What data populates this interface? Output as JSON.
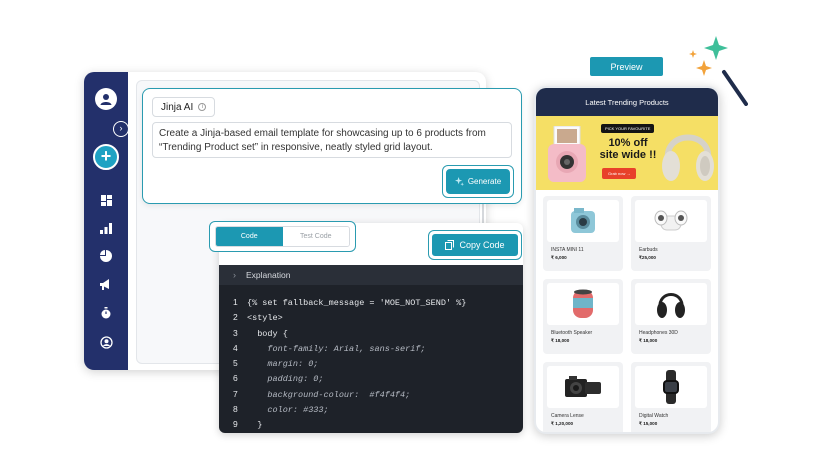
{
  "prompt": {
    "chip_label": "Jinja AI",
    "info_icon": "info-icon",
    "text": "Create a Jinja-based email template for showcasing up to 6 products from “Trending Product set” in responsive, neatly styled grid layout.",
    "generate_label": "Generate"
  },
  "code_panel": {
    "tabs": [
      {
        "label": "Code"
      },
      {
        "label": "Test Code"
      }
    ],
    "copy_label": "Copy Code",
    "explanation_label": "Explanation",
    "lines": [
      {
        "n": "1",
        "text": "{% set fallback_message = 'MOE_NOT_SEND'  %}"
      },
      {
        "n": "2",
        "text": "<style>"
      },
      {
        "n": "3",
        "text": "  body {"
      },
      {
        "n": "4",
        "text": "    font-family: Arial, sans-serif;"
      },
      {
        "n": "5",
        "text": "    margin: 0;"
      },
      {
        "n": "6",
        "text": "    padding: 0;"
      },
      {
        "n": "7",
        "text": "    background-colour:  #f4f4f4;"
      },
      {
        "n": "8",
        "text": "    color: #333;"
      },
      {
        "n": "9",
        "text": "  }"
      }
    ]
  },
  "preview": {
    "button_label": "Preview",
    "header_title": "Latest Trending Products",
    "banner": {
      "tag": "PICK YOUR FAVOURITE",
      "headline_1": "10% off",
      "headline_2": "site wide !!",
      "cta": "Grab now →"
    },
    "products": [
      {
        "name": "INSTA MINI 11",
        "price": "₹ 6,000"
      },
      {
        "name": "Earbuds",
        "price": "₹25,000"
      },
      {
        "name": "Bluetooth Speaker",
        "price": "₹ 18,000"
      },
      {
        "name": "Headphones 30D",
        "price": "₹ 18,000"
      },
      {
        "name": "Camera Lense",
        "price": "₹ 1,20,000"
      },
      {
        "name": "Digital Watch",
        "price": "₹ 15,000"
      }
    ]
  },
  "colors": {
    "accent": "#1c98b2",
    "sidebar": "#23306b",
    "code_bg": "#1e2229",
    "banner": "#f5df65"
  }
}
